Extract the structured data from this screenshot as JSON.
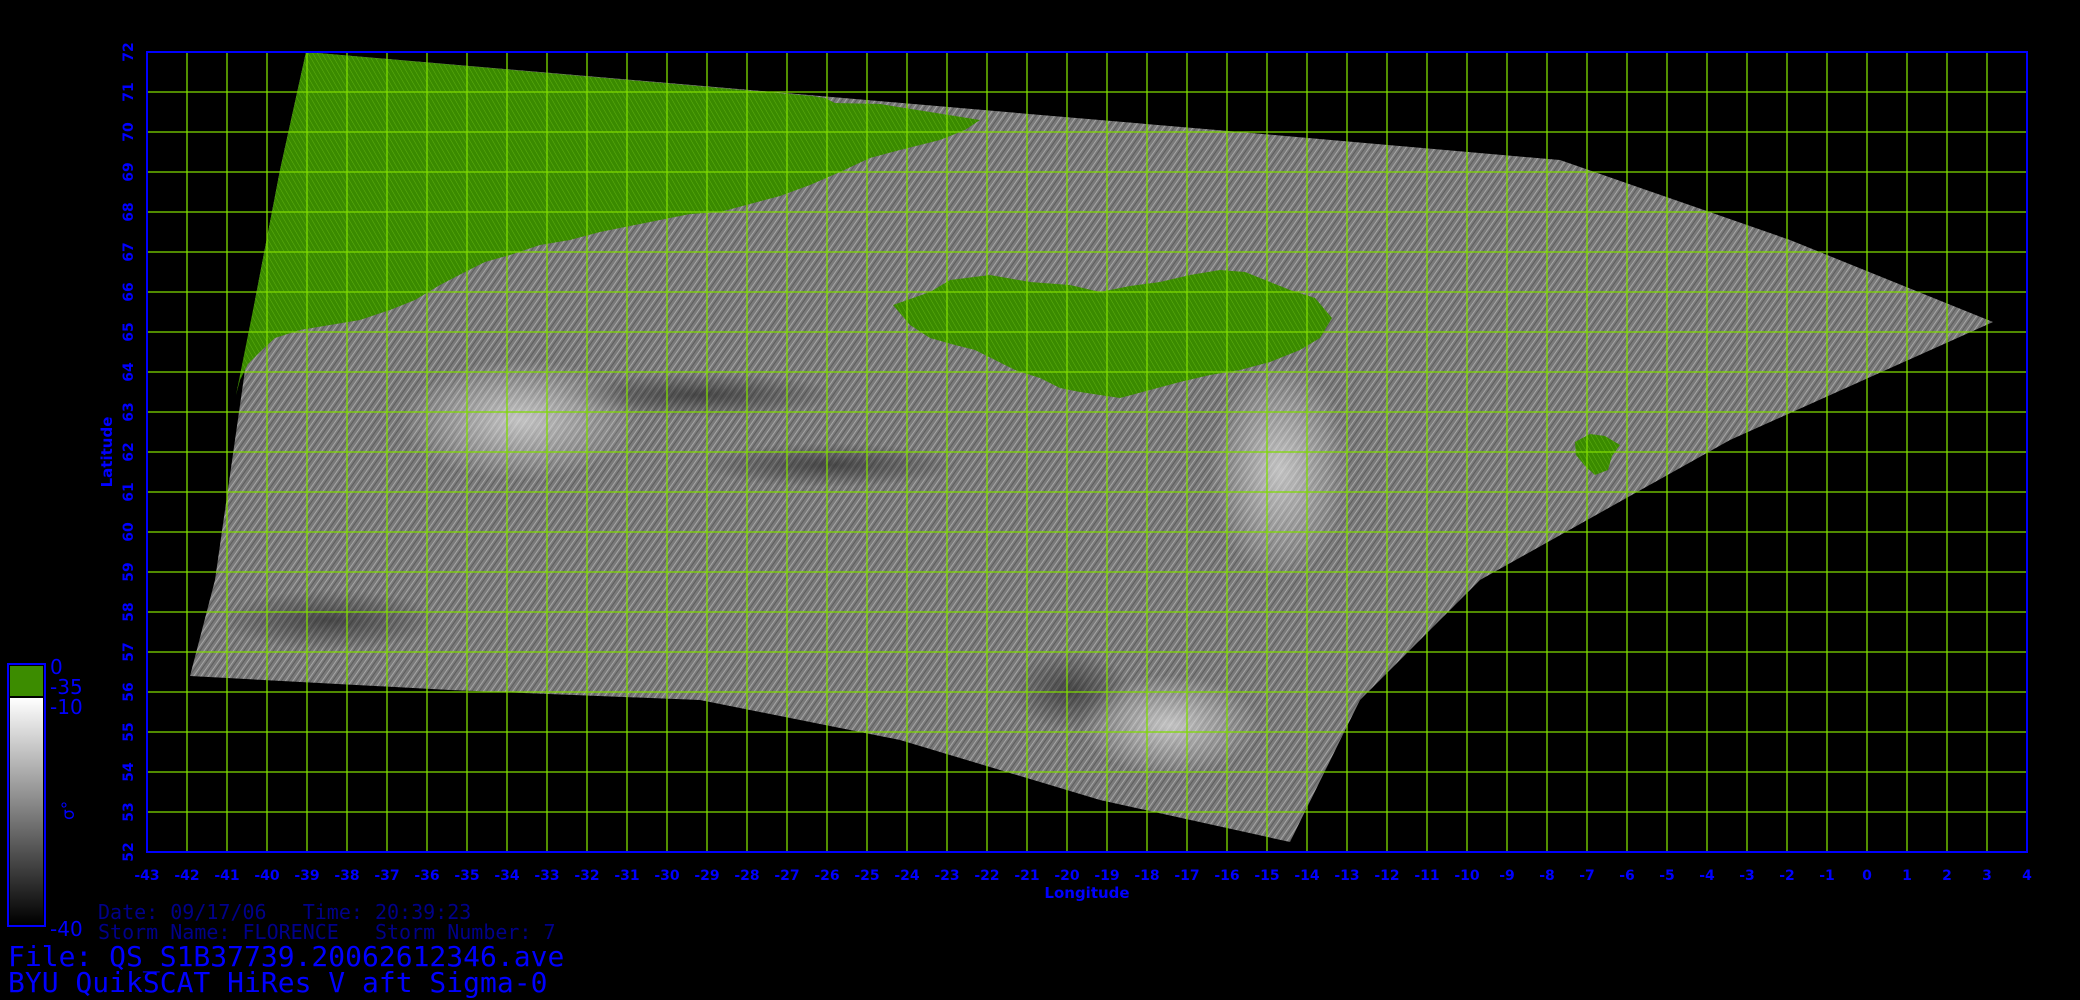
{
  "map": {
    "x_axis_label": "Longitude",
    "y_axis_label": "Latitude",
    "lon_ticks": [
      -43,
      -42,
      -41,
      -40,
      -39,
      -38,
      -37,
      -36,
      -35,
      -34,
      -33,
      -32,
      -31,
      -30,
      -29,
      -28,
      -27,
      -26,
      -25,
      -24,
      -23,
      -22,
      -21,
      -20,
      -19,
      -18,
      -17,
      -16,
      -15,
      -14,
      -13,
      -12,
      -11,
      -10,
      -9,
      -8,
      -7,
      -6,
      -5,
      -4,
      -3,
      -2,
      -1,
      0,
      1,
      2,
      3,
      4
    ],
    "lat_ticks": [
      52,
      53,
      54,
      55,
      56,
      57,
      58,
      59,
      60,
      61,
      62,
      63,
      64,
      65,
      66,
      67,
      68,
      69,
      70,
      71,
      72
    ],
    "lon_range": [
      -43,
      4
    ],
    "lat_range": [
      52,
      72
    ],
    "grid_color": "#7fdc00",
    "frame_color": "#0000ff",
    "land_color": "#3c8c00",
    "ocean_gray": "#8a8a8a"
  },
  "colorbar": {
    "land_top_label": "0",
    "land_bottom_label": "-35",
    "ocean_top_label": "-10",
    "ocean_bottom_label": "-40",
    "symbol": "σ°",
    "land_color": "#3c8c00"
  },
  "info": {
    "date_line": "Date: 09/17/06   Time: 20:39:23",
    "storm_line": "Storm Name: FLORENCE   Storm Number: 7",
    "file_line": "File: QS_S1B37739.20062612346.ave",
    "product_line": "BYU QuikSCAT HiRes V aft Sigma-0"
  }
}
